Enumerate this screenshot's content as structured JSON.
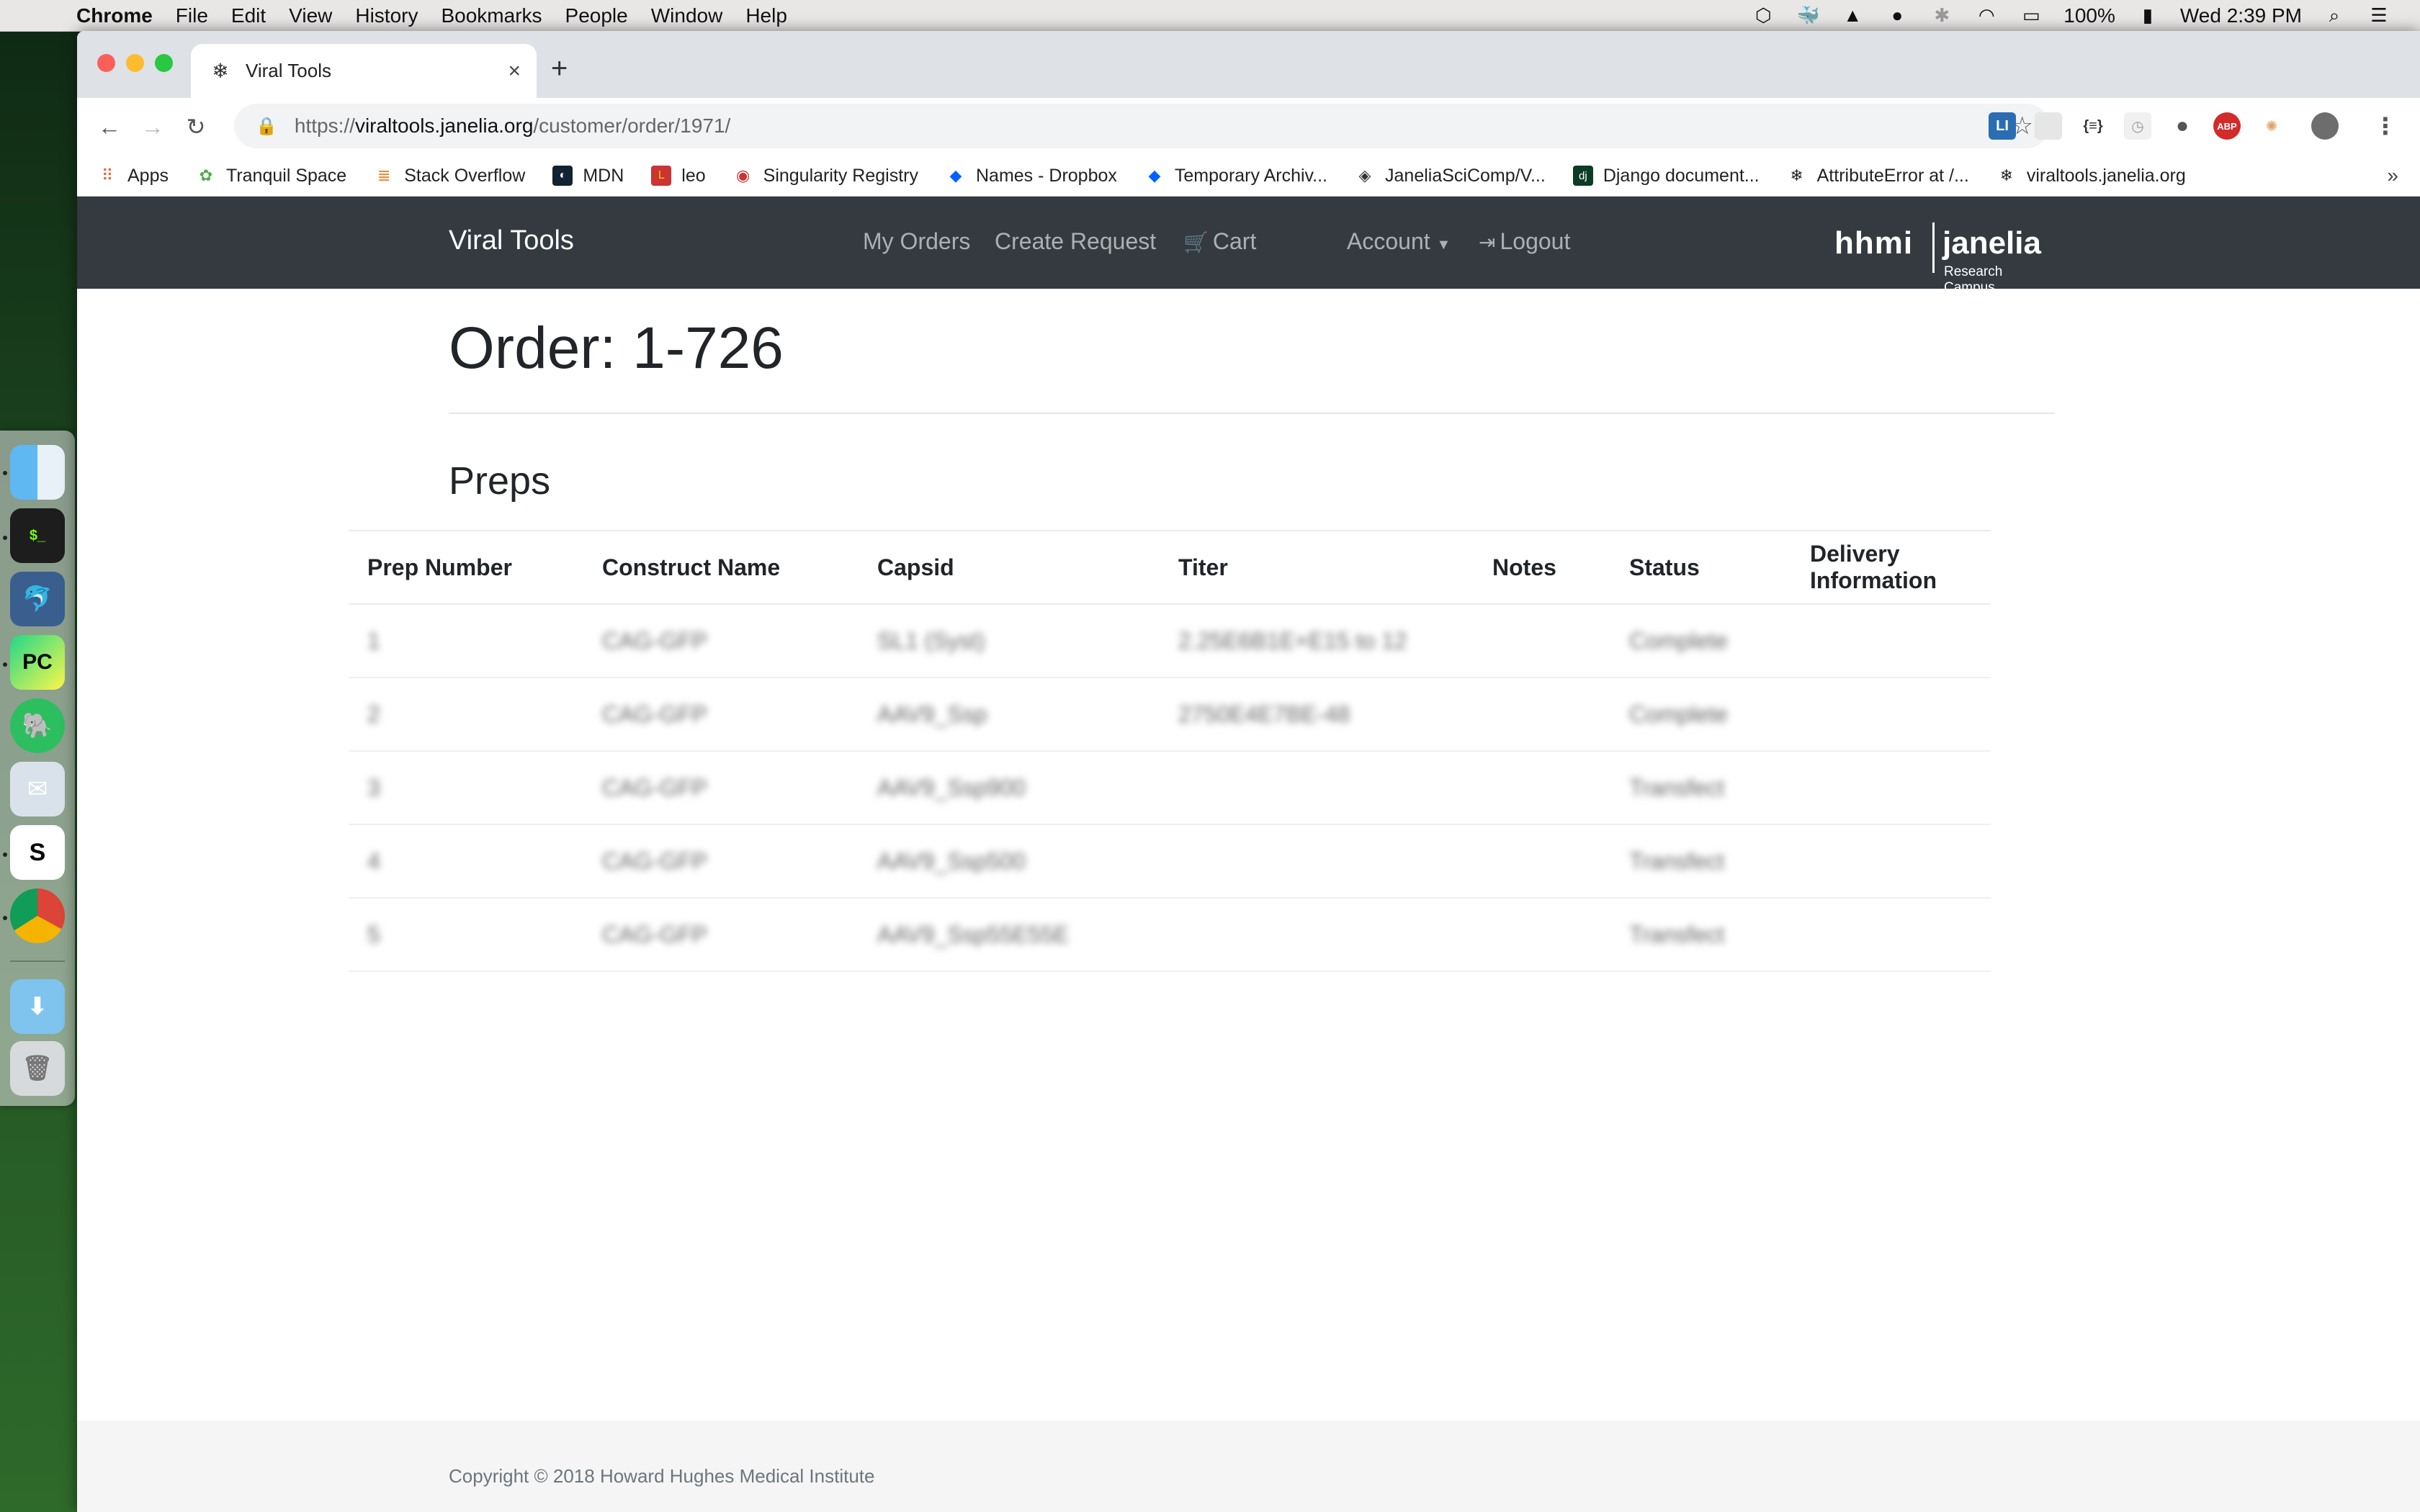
{
  "menubar": {
    "app": "Chrome",
    "items": [
      "File",
      "Edit",
      "View",
      "History",
      "Bookmarks",
      "People",
      "Window",
      "Help"
    ],
    "battery": "100%",
    "clock": "Wed 2:39 PM"
  },
  "browser": {
    "tab_title": "Viral Tools",
    "url_proto": "https://",
    "url_host": "viraltools.janelia.org",
    "url_path": "/customer/order/1971/",
    "bookmarks": [
      "Apps",
      "Tranquil Space",
      "Stack Overflow",
      "MDN",
      "leo",
      "Singularity Registry",
      "Names - Dropbox",
      "Temporary Archiv...",
      "JaneliaSciComp/V...",
      "Django document...",
      "AttributeError at /...",
      "viraltools.janelia.org"
    ],
    "bookmarks_more": "»",
    "extensions": [
      "LI",
      "{≡}",
      "ABP"
    ]
  },
  "site": {
    "brand": "Viral Tools",
    "nav": {
      "my_orders": "My Orders",
      "create_request": "Create Request",
      "cart": "Cart",
      "account": "Account",
      "logout": "Logout"
    },
    "logo": {
      "hhmi": "hhmi",
      "janelia": "janelia",
      "campus": "Research Campus"
    }
  },
  "order": {
    "title": "Order: 1-726",
    "section": "Preps",
    "columns": [
      "Prep Number",
      "Construct Name",
      "Capsid",
      "Titer",
      "Notes",
      "Status",
      "Delivery Information"
    ],
    "rows": [
      [
        "1",
        "CAG-GFP",
        "SL1 (Syst)",
        "2.25E6B1E+E15 to 12",
        "",
        "Complete",
        ""
      ],
      [
        "2",
        "CAG-GFP",
        "AAV9_Ssp",
        "2750E4E7BE-48",
        "",
        "Complete",
        ""
      ],
      [
        "3",
        "CAG-GFP",
        "AAV9_Ssp900",
        "",
        "",
        "Transfect",
        ""
      ],
      [
        "4",
        "CAG-GFP",
        "AAV9_Ssp500",
        "",
        "",
        "Transfect",
        ""
      ],
      [
        "5",
        "CAG-GFP",
        "AAV9_Ssp55E55E",
        "",
        "",
        "Transfect",
        ""
      ]
    ]
  },
  "footer": {
    "copyright": "Copyright © 2018 Howard Hughes Medical Institute"
  }
}
